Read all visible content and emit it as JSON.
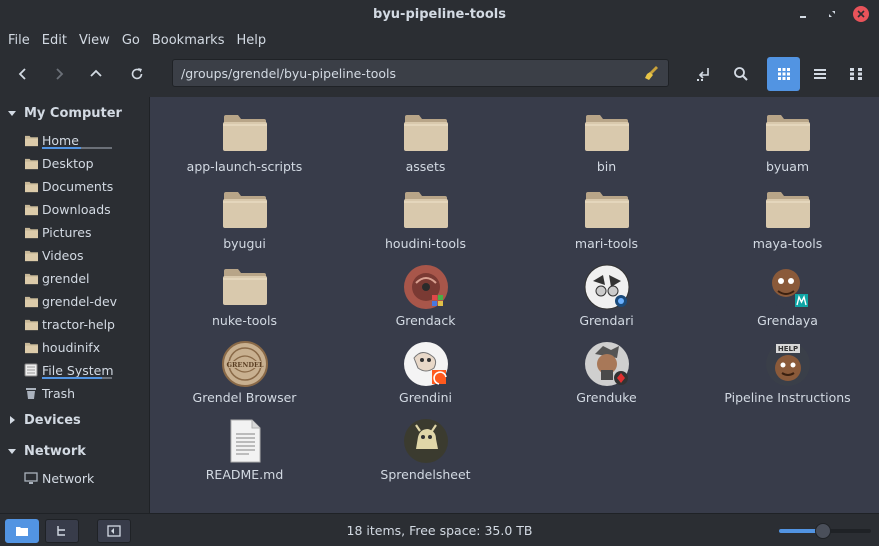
{
  "window": {
    "title": "byu-pipeline-tools"
  },
  "menu": [
    "File",
    "Edit",
    "View",
    "Go",
    "Bookmarks",
    "Help"
  ],
  "toolbar": {
    "path": "/groups/grendel/byu-pipeline-tools"
  },
  "sidebar": {
    "my_computer": "My Computer",
    "items": [
      {
        "label": "Home",
        "icon": "home-folder-icon",
        "usage": 0.55
      },
      {
        "label": "Desktop",
        "icon": "folder-icon"
      },
      {
        "label": "Documents",
        "icon": "folder-icon"
      },
      {
        "label": "Downloads",
        "icon": "folder-icon"
      },
      {
        "label": "Pictures",
        "icon": "folder-icon"
      },
      {
        "label": "Videos",
        "icon": "folder-icon"
      },
      {
        "label": "grendel",
        "icon": "folder-icon"
      },
      {
        "label": "grendel-dev",
        "icon": "folder-icon"
      },
      {
        "label": "tractor-help",
        "icon": "folder-icon"
      },
      {
        "label": "houdinifx",
        "icon": "folder-icon"
      },
      {
        "label": "File System",
        "icon": "drive-icon",
        "usage": 0.85
      },
      {
        "label": "Trash",
        "icon": "trash-icon"
      }
    ],
    "devices": "Devices",
    "network": "Network",
    "network_items": [
      {
        "label": "Network",
        "icon": "network-icon"
      }
    ]
  },
  "files": [
    {
      "name": "app-launch-scripts",
      "kind": "folder"
    },
    {
      "name": "assets",
      "kind": "folder"
    },
    {
      "name": "bin",
      "kind": "folder"
    },
    {
      "name": "byuam",
      "kind": "folder"
    },
    {
      "name": "byugui",
      "kind": "folder"
    },
    {
      "name": "houdini-tools",
      "kind": "folder"
    },
    {
      "name": "mari-tools",
      "kind": "folder"
    },
    {
      "name": "maya-tools",
      "kind": "folder"
    },
    {
      "name": "nuke-tools",
      "kind": "folder"
    },
    {
      "name": "Grendack",
      "kind": "app"
    },
    {
      "name": "Grendari",
      "kind": "app"
    },
    {
      "name": "Grendaya",
      "kind": "app"
    },
    {
      "name": "Grendel Browser",
      "kind": "app"
    },
    {
      "name": "Grendini",
      "kind": "app"
    },
    {
      "name": "Grenduke",
      "kind": "app"
    },
    {
      "name": "Pipeline Instructions",
      "kind": "app"
    },
    {
      "name": "README.md",
      "kind": "text"
    },
    {
      "name": "Sprendelsheet",
      "kind": "app"
    }
  ],
  "icon_badges": {
    "grendel_browser_label": "GRENDEL",
    "pipeline_instructions_label": "HELP"
  },
  "status": {
    "text": "18 items, Free space: 35.0 TB",
    "zoom": 0.48
  },
  "colors": {
    "accent": "#5294e2",
    "folder": "#d2c2a6",
    "background": "#383c4a",
    "sidebar": "#2b2e33"
  }
}
